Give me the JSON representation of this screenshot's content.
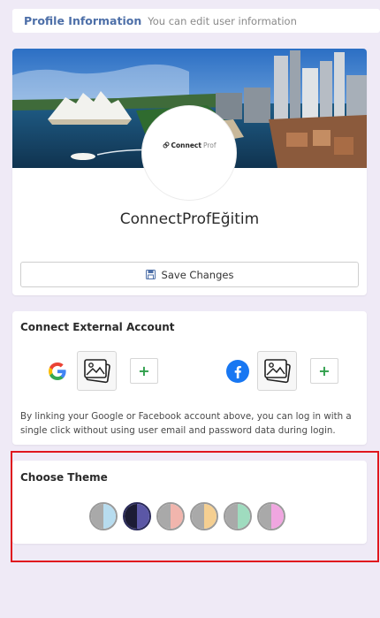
{
  "header": {
    "title": "Profile Information",
    "subtitle": "You can edit user information"
  },
  "profile": {
    "logo_connect": "Connect",
    "logo_prof": "Prof",
    "username": "ConnectProfEğitim",
    "save_label": "Save Changes"
  },
  "external": {
    "title": "Connect External Account",
    "providers": [
      {
        "name": "google",
        "icon": "google-icon",
        "add_label": "+"
      },
      {
        "name": "facebook",
        "icon": "facebook-icon",
        "add_label": "+"
      }
    ],
    "description": "By linking your Google or Facebook account above, you can log in with a single click without using user email and password data during login."
  },
  "theme": {
    "title": "Choose Theme",
    "options": [
      {
        "left": "#a9a9a9",
        "right": "#b7dcef",
        "selected": false
      },
      {
        "left": "#1c1c34",
        "right": "#5b57a6",
        "selected": true
      },
      {
        "left": "#a9a9a9",
        "right": "#f1b5ad",
        "selected": false
      },
      {
        "left": "#a9a9a9",
        "right": "#f5cf91",
        "selected": false
      },
      {
        "left": "#a9a9a9",
        "right": "#9fdcbf",
        "selected": false
      },
      {
        "left": "#a9a9a9",
        "right": "#f0a6e0",
        "selected": false
      }
    ]
  },
  "colors": {
    "accent": "#4d6fa8",
    "highlight": "#e0161e",
    "add_green": "#2e9e4a"
  }
}
